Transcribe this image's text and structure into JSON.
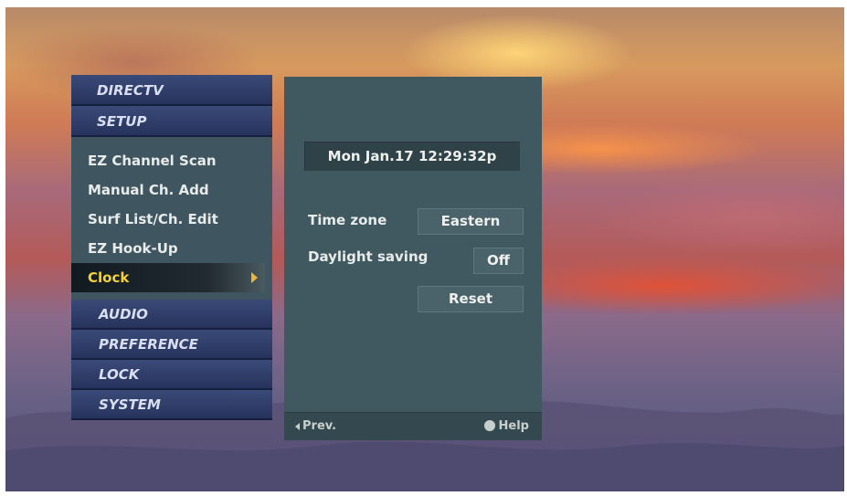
{
  "menu": {
    "brand": "DIRECTV",
    "section": "SETUP",
    "items": [
      {
        "label": "EZ Channel Scan"
      },
      {
        "label": "Manual Ch. Add"
      },
      {
        "label": "Surf List/Ch. Edit"
      },
      {
        "label": "EZ Hook-Up"
      },
      {
        "label": "Clock"
      }
    ],
    "selected": "Clock",
    "categories": [
      "AUDIO",
      "PREFERENCE",
      "LOCK",
      "SYSTEM"
    ]
  },
  "clock_panel": {
    "datetime": "Mon Jan.17  12:29:32p",
    "time_zone_label": "Time zone",
    "time_zone_value": "Eastern",
    "daylight_label": "Daylight saving",
    "daylight_value": "Off",
    "reset_label": "Reset"
  },
  "footer": {
    "prev_label": "Prev.",
    "help_label": "Help"
  },
  "colors": {
    "menu_header": "#26335c",
    "submenu_bg": "#3f5560",
    "selected_text": "#f2d13a",
    "panel_bg": "#40585f"
  }
}
